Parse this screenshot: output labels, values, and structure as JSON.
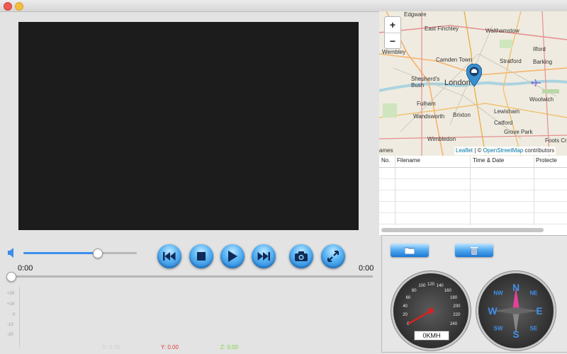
{
  "player": {
    "time_current": "0:00",
    "time_total": "0:00",
    "volume": 0.65,
    "seek_position": 0,
    "controls": {
      "previous": "skip-back-icon",
      "stop": "stop-icon",
      "play": "play-icon",
      "next": "skip-forward-icon",
      "snapshot": "camera-icon",
      "fullscreen": "fullscreen-icon"
    }
  },
  "graph": {
    "ticks": [
      "+20",
      "+10",
      "0",
      "-10",
      "-20"
    ],
    "x_label": "X: 0.00",
    "y_label": "Y: 0.00",
    "z_label": "Z: 0.00",
    "colors": {
      "x": "#cfcfcf",
      "y": "#e23b3b",
      "z": "#7dd23f"
    }
  },
  "map": {
    "zoom_in": "+",
    "zoom_out": "−",
    "labels": [
      "Edgware",
      "East Finchley",
      "Walthamstow",
      "Wembley",
      "Ilford",
      "Camden Town",
      "Stratford",
      "Barking",
      "Shepherd's Bush",
      "London",
      "Woolwich",
      "Fulham",
      "Lewisham",
      "Wandsworth",
      "Brixton",
      "Catford",
      "Grove Park",
      "Wimbledon",
      "Foots Cr",
      "ames"
    ],
    "attribution": {
      "leaflet": "Leaflet",
      "separator": " | © ",
      "osm": "OpenStreetMap",
      "suffix": " contributors"
    }
  },
  "file_table": {
    "columns": [
      "No.",
      "Filename",
      "Time & Date",
      "Protecte"
    ],
    "rows": []
  },
  "panel": {
    "folder_button_icon": "folder-icon",
    "trash_button_icon": "trash-icon"
  },
  "speedometer": {
    "value": 0,
    "readout": "0KMH",
    "ticks": [
      "0",
      "20",
      "40",
      "60",
      "80",
      "100",
      "120",
      "140",
      "160",
      "180",
      "200",
      "220",
      "240"
    ]
  },
  "compass": {
    "n": "N",
    "s": "S",
    "e": "E",
    "w": "W",
    "ne": "NE",
    "nw": "NW",
    "se": "SE",
    "sw": "SW"
  }
}
